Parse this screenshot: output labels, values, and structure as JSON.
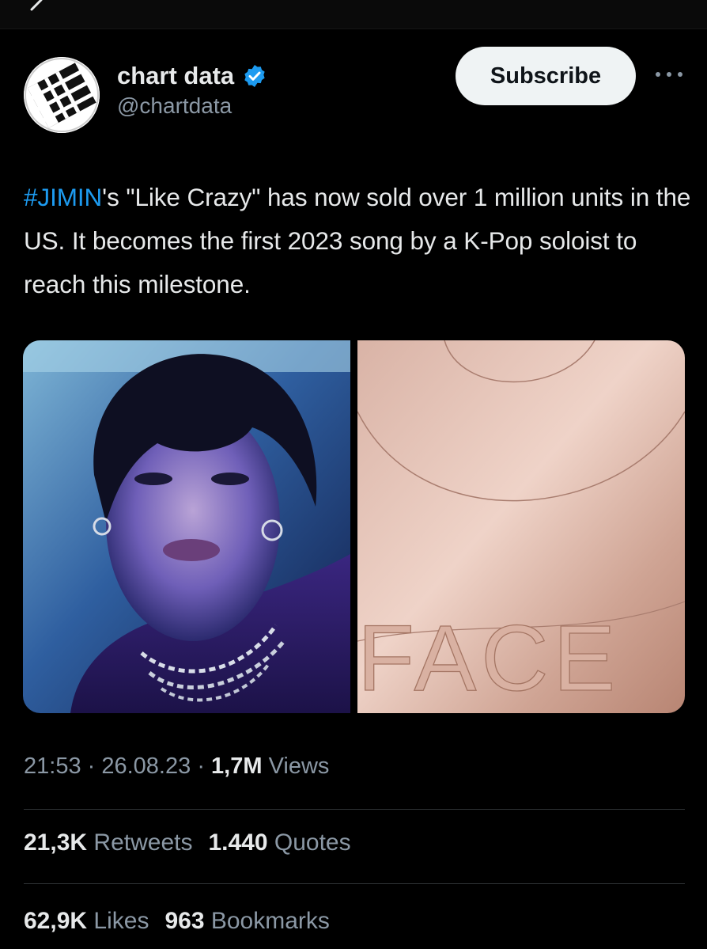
{
  "account": {
    "name": "chart data",
    "handle": "@chartdata",
    "verified": true,
    "subscribe_label": "Subscribe"
  },
  "tweet": {
    "hashtag": "#JIMIN",
    "text_after_hashtag": "'s \"Like Crazy\" has now sold over 1 million units in the US. It becomes the first 2023 song by a K-Pop soloist to reach this milestone."
  },
  "media": {
    "cover_text": "FACE"
  },
  "meta": {
    "time": "21:53",
    "date": "26.08.23",
    "views_count": "1,7M",
    "views_label": "Views"
  },
  "engagement": {
    "retweets_count": "21,3K",
    "retweets_label": "Retweets",
    "quotes_count": "1.440",
    "quotes_label": "Quotes",
    "likes_count": "62,9K",
    "likes_label": "Likes",
    "bookmarks_count": "963",
    "bookmarks_label": "Bookmarks"
  },
  "colors": {
    "background": "#000000",
    "text": "#e7e9ea",
    "secondary": "#8b98a5",
    "accent": "#1d9bf0",
    "subscribe_bg": "#eff3f4"
  },
  "icons": [
    "back-arrow-icon",
    "verified-badge-icon",
    "more-options-icon"
  ]
}
